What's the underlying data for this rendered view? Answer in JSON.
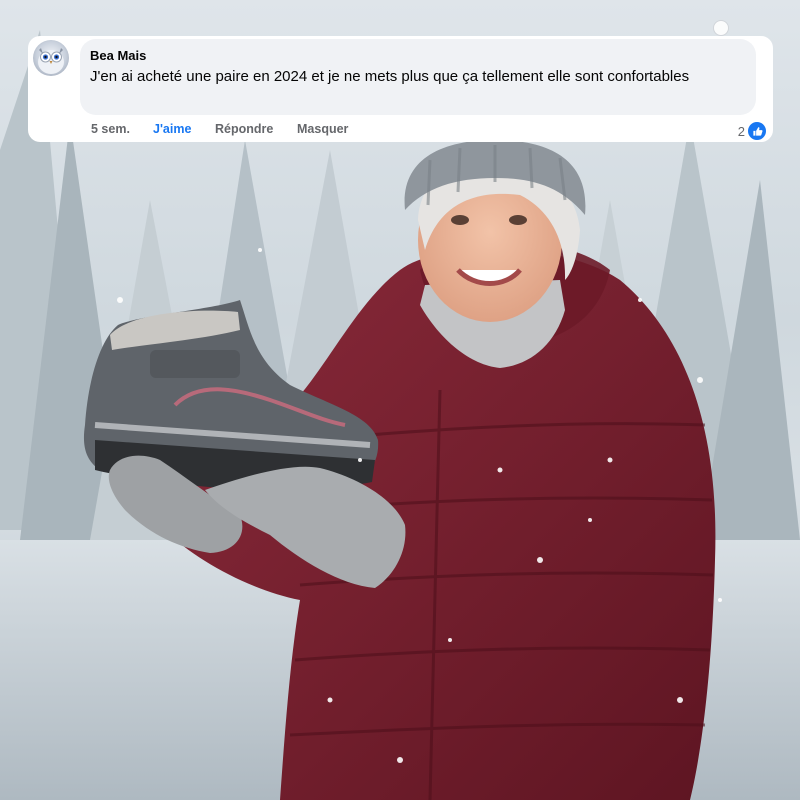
{
  "comment": {
    "author": "Bea Mais",
    "text": "J'en ai acheté une paire en 2024 et je ne mets plus que ça tellement elle sont confortables",
    "time": "5 sem.",
    "like_label": "J'aime",
    "reply_label": "Répondre",
    "hide_label": "Masquer",
    "reaction_count": "2"
  },
  "icons": {
    "avatar": "owl-avatar",
    "reaction": "thumbs-up-icon"
  },
  "colors": {
    "like_blue": "#1877f2",
    "bubble": "#f0f2f5",
    "jacket": "#7a1f2e"
  }
}
